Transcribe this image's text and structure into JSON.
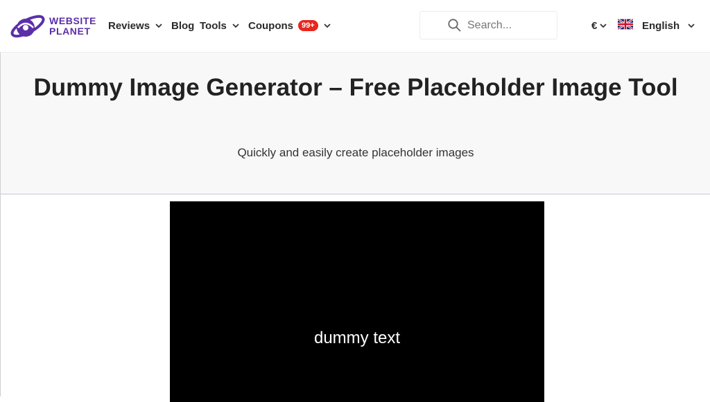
{
  "brand": {
    "name_line1": "WEBSITE",
    "name_line2": "PLANET",
    "color": "#5b2fa8"
  },
  "nav": {
    "reviews": "Reviews",
    "blog": "Blog",
    "tools": "Tools",
    "coupons": "Coupons",
    "coupons_badge": "99+",
    "badge_color": "#e8261d"
  },
  "search": {
    "placeholder": "Search..."
  },
  "currency": {
    "symbol": "€"
  },
  "language": {
    "label": "English",
    "flag_icon": "uk-flag-icon"
  },
  "hero": {
    "title": "Dummy Image Generator – Free Placeholder Image Tool",
    "subtitle": "Quickly and easily create placeholder images"
  },
  "preview": {
    "text": "dummy text",
    "background_color": "#000000",
    "text_color": "#ffffff"
  }
}
